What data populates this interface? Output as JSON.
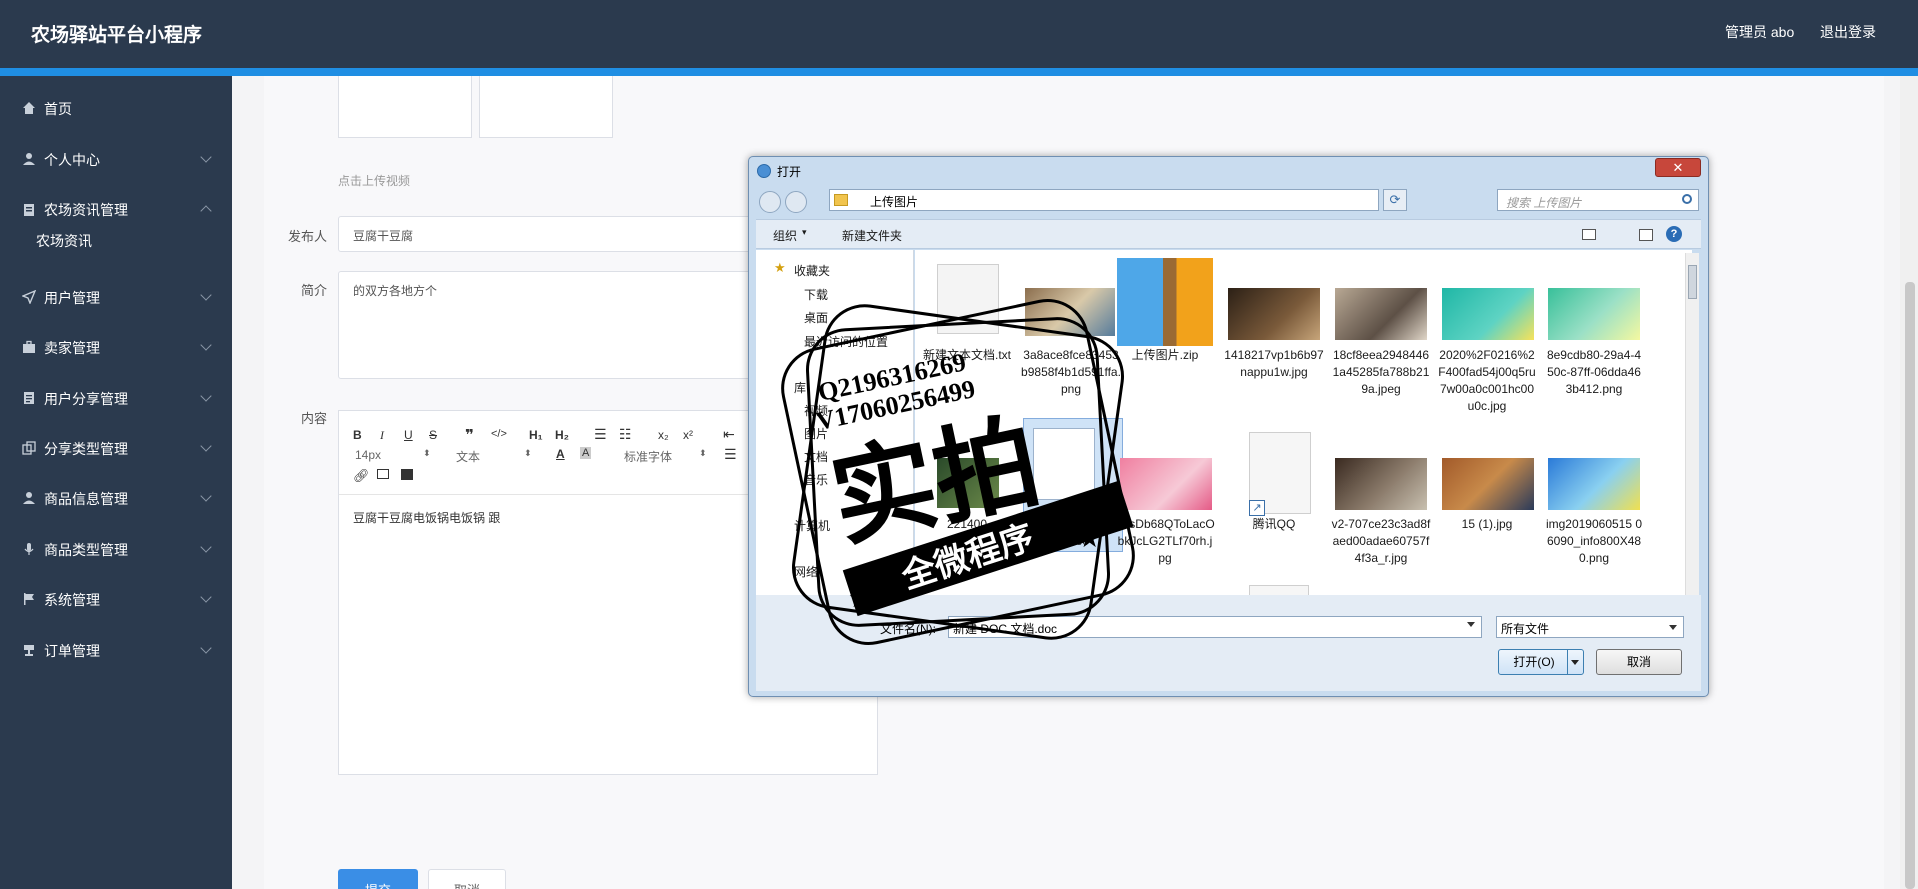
{
  "header": {
    "title": "农场驿站平台小程序",
    "admin_label": "管理员 abo",
    "logout": "退出登录"
  },
  "sidebar": {
    "items": [
      {
        "label": "首页"
      },
      {
        "label": "个人中心"
      },
      {
        "label": "农场资讯管理"
      },
      {
        "label": "用户管理"
      },
      {
        "label": "卖家管理"
      },
      {
        "label": "用户分享管理"
      },
      {
        "label": "分享类型管理"
      },
      {
        "label": "商品信息管理"
      },
      {
        "label": "商品类型管理"
      },
      {
        "label": "系统管理"
      },
      {
        "label": "订单管理"
      }
    ],
    "subitem": "农场资讯"
  },
  "form": {
    "upload_tip": "点击上传视频",
    "publisher_label": "发布人",
    "publisher_value": "豆腐干豆腐",
    "intro_label": "简介",
    "intro_value": "的双方各地方个",
    "content_label": "内容",
    "editor": {
      "font_size": "14px",
      "block_type": "文本",
      "font_family": "标准字体",
      "content": "豆腐干豆腐电饭锅电饭锅 跟"
    },
    "submit": "提交",
    "cancel": "取消"
  },
  "dialog": {
    "title": "打开",
    "path": "上传图片",
    "search_placeholder": "搜索 上传图片",
    "organize": "组织",
    "new_folder": "新建文件夹",
    "nav": {
      "favorites": "收藏夹",
      "downloads": "下载",
      "desktop": "桌面",
      "recent": "最近访问的位置",
      "library": "库",
      "videos": "视频",
      "pictures": "图片",
      "documents": "文档",
      "music": "音乐",
      "computer": "计算机",
      "network": "网络"
    },
    "files": [
      {
        "name": "新建文本文档.txt"
      },
      {
        "name": "3a8ace8fce83453b9858f4b1d591ffa.png"
      },
      {
        "name": "上传图片.zip"
      },
      {
        "name": "1418217vp1b6b97nappu1w.jpg"
      },
      {
        "name": "18cf8eea29484461a45285fa788b219a.jpeg"
      },
      {
        "name": "2020%2F0216%2F400fad54j00q5ru7w00a0c001hc00u0c.jpg"
      },
      {
        "name": "8e9cdb80-29a4-450c-87ff-06dda463b412.png"
      },
      {
        "name": "221400"
      },
      {
        "name": "新建 DOC 文档.doc"
      },
      {
        "name": "FosDb68QToLacObkJcLG2TLf70rh.jpg"
      },
      {
        "name": "腾讯QQ"
      },
      {
        "name": "v2-707ce23c3ad8faed00adae60757f4f3a_r.jpg"
      },
      {
        "name": "15 (1).jpg"
      },
      {
        "name": "img2019060515 06090_info800X480.png"
      }
    ],
    "filename_label": "文件名(N):",
    "filename_value": "新建 DOC 文档.doc",
    "filetype": "所有文件",
    "open_btn": "打开(O)",
    "cancel_btn": "取消"
  },
  "watermark": {
    "line1": "Q2196316269",
    "line2": "V17060256499",
    "big": "实拍",
    "banner": "全微程序"
  },
  "colors": {
    "nav_bg": "#2b3a4e",
    "accent": "#1f8ee3",
    "primary_btn": "#3a8ee6"
  }
}
